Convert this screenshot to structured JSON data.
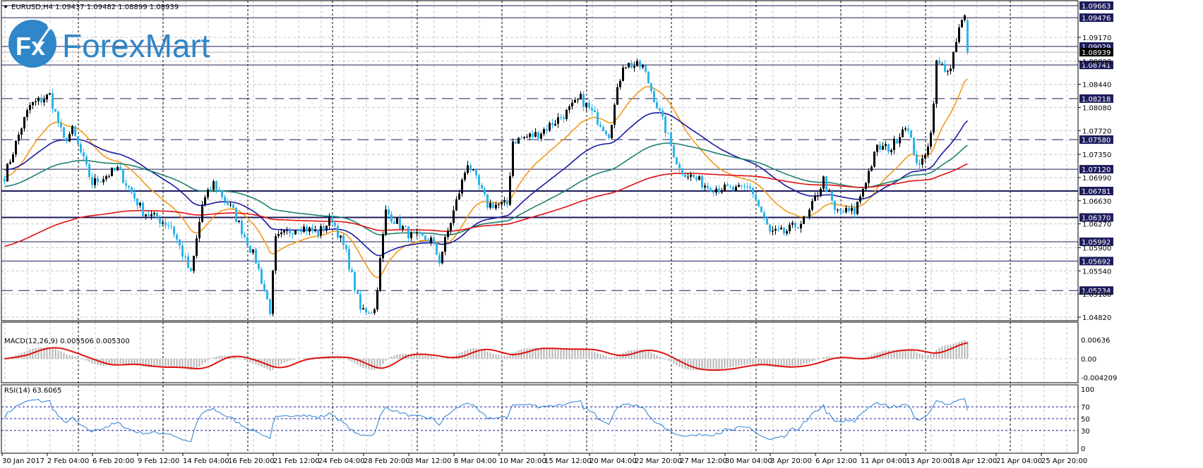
{
  "header": {
    "symbol_line": "EURUSD,H4  1.09437 1.09482 1.08899 1.08939"
  },
  "logo": {
    "badge": "Fx",
    "text": "ForexMart",
    "color": "#2f86c8"
  },
  "chart_data": {
    "type": "candlestick",
    "symbol": "EURUSD",
    "timeframe": "H4",
    "ohlc_last": {
      "open": 1.09437,
      "high": 1.09482,
      "low": 1.08899,
      "close": 1.08939
    },
    "current_price": "1.08939",
    "ylim": [
      1.0482,
      1.09663
    ],
    "price_ticks": [
      "1.09170",
      "1.08800",
      "1.08440",
      "1.08080",
      "1.07720",
      "1.07350",
      "1.06990",
      "1.06630",
      "1.06270",
      "1.05900",
      "1.05540",
      "1.05180",
      "1.04820"
    ],
    "levels": [
      {
        "price": "1.09663",
        "style": "solid"
      },
      {
        "price": "1.09476",
        "style": "solid"
      },
      {
        "price": "1.09029",
        "style": "solid"
      },
      {
        "price": "1.08741",
        "style": "solid"
      },
      {
        "price": "1.08218",
        "style": "dashed"
      },
      {
        "price": "1.07580",
        "style": "dashed"
      },
      {
        "price": "1.07120",
        "style": "solid"
      },
      {
        "price": "1.06781",
        "style": "thick"
      },
      {
        "price": "1.06370",
        "style": "thick"
      },
      {
        "price": "1.05992",
        "style": "solid"
      },
      {
        "price": "1.05692",
        "style": "solid"
      },
      {
        "price": "1.05234",
        "style": "dashed"
      }
    ],
    "bar_count": 342,
    "price_path": [
      [
        0,
        1.0701
      ],
      [
        6,
        1.0778
      ],
      [
        9,
        1.0811
      ],
      [
        16,
        1.0827
      ],
      [
        21,
        1.0756
      ],
      [
        24,
        1.0772
      ],
      [
        31,
        1.069
      ],
      [
        40,
        1.0712
      ],
      [
        49,
        1.0646
      ],
      [
        59,
        1.0624
      ],
      [
        66,
        1.0548
      ],
      [
        70,
        1.0657
      ],
      [
        74,
        1.069
      ],
      [
        81,
        1.0646
      ],
      [
        89,
        1.057
      ],
      [
        94,
        1.0493
      ],
      [
        96,
        1.0602
      ],
      [
        104,
        1.0624
      ],
      [
        111,
        1.0613
      ],
      [
        116,
        1.0635
      ],
      [
        121,
        1.0581
      ],
      [
        126,
        1.0493
      ],
      [
        131,
        1.0493
      ],
      [
        135,
        1.0646
      ],
      [
        144,
        1.0608
      ],
      [
        151,
        1.0602
      ],
      [
        154,
        1.057
      ],
      [
        159,
        1.0646
      ],
      [
        164,
        1.0723
      ],
      [
        171,
        1.0657
      ],
      [
        178,
        1.0657
      ],
      [
        180,
        1.0756
      ],
      [
        189,
        1.0767
      ],
      [
        199,
        1.08
      ],
      [
        204,
        1.0822
      ],
      [
        214,
        1.0767
      ],
      [
        219,
        1.0876
      ],
      [
        226,
        1.0871
      ],
      [
        231,
        1.0811
      ],
      [
        239,
        1.0712
      ],
      [
        249,
        1.0685
      ],
      [
        259,
        1.0679
      ],
      [
        264,
        1.0685
      ],
      [
        271,
        1.0613
      ],
      [
        276,
        1.0613
      ],
      [
        284,
        1.0635
      ],
      [
        290,
        1.0696
      ],
      [
        294,
        1.0646
      ],
      [
        301,
        1.0646
      ],
      [
        309,
        1.0745
      ],
      [
        314,
        1.0745
      ],
      [
        319,
        1.0783
      ],
      [
        324,
        1.0712
      ],
      [
        328,
        1.0767
      ],
      [
        330,
        1.0876
      ],
      [
        335,
        1.0865
      ],
      [
        338,
        1.0931
      ],
      [
        340,
        1.0948
      ],
      [
        341,
        1.08939
      ]
    ],
    "moving_averages": [
      {
        "period": 21,
        "color": "#f29a1a",
        "start": 1.07
      },
      {
        "period": 50,
        "color": "#1a1aa0",
        "start": 1.0712
      },
      {
        "period": 100,
        "color": "#1e8070",
        "start": 1.0685
      },
      {
        "period": 200,
        "color": "#e01010",
        "start": 1.0591
      }
    ],
    "bull_color": "#000000",
    "bear_color": "#2db4ea",
    "x_labels": [
      "30 Jan 2017",
      "2 Feb 04:00",
      "6 Feb 20:00",
      "9 Feb 12:00",
      "14 Feb 04:00",
      "16 Feb 20:00",
      "21 Feb 12:00",
      "24 Feb 04:00",
      "28 Feb 20:00",
      "3 Mar 12:00",
      "8 Mar 04:00",
      "10 Mar 20:00",
      "15 Mar 12:00",
      "20 Mar 04:00",
      "22 Mar 20:00",
      "27 Mar 12:00",
      "30 Mar 04:00",
      "3 Apr 20:00",
      "6 Apr 12:00",
      "11 Apr 04:00",
      "13 Apr 20:00",
      "18 Apr 12:00",
      "21 Apr 04:00",
      "25 Apr 20:00"
    ],
    "macd": {
      "label": "MACD(12,26,9) 0.005506 0.005300",
      "fast": 12,
      "slow": 26,
      "signal": 9,
      "ylim": [
        -0.004209,
        0.00636
      ],
      "ticks": [
        "0.00636",
        "0.00",
        "-0.004209"
      ],
      "hist_color": "#b4b4b4",
      "signal_color": "#e01010"
    },
    "rsi": {
      "label": "RSI(14) 63.6065",
      "period": 14,
      "ylim": [
        0,
        100
      ],
      "ticks": [
        "100",
        "70",
        "50",
        "30",
        "0"
      ],
      "line_color": "#2a7fd4"
    }
  }
}
